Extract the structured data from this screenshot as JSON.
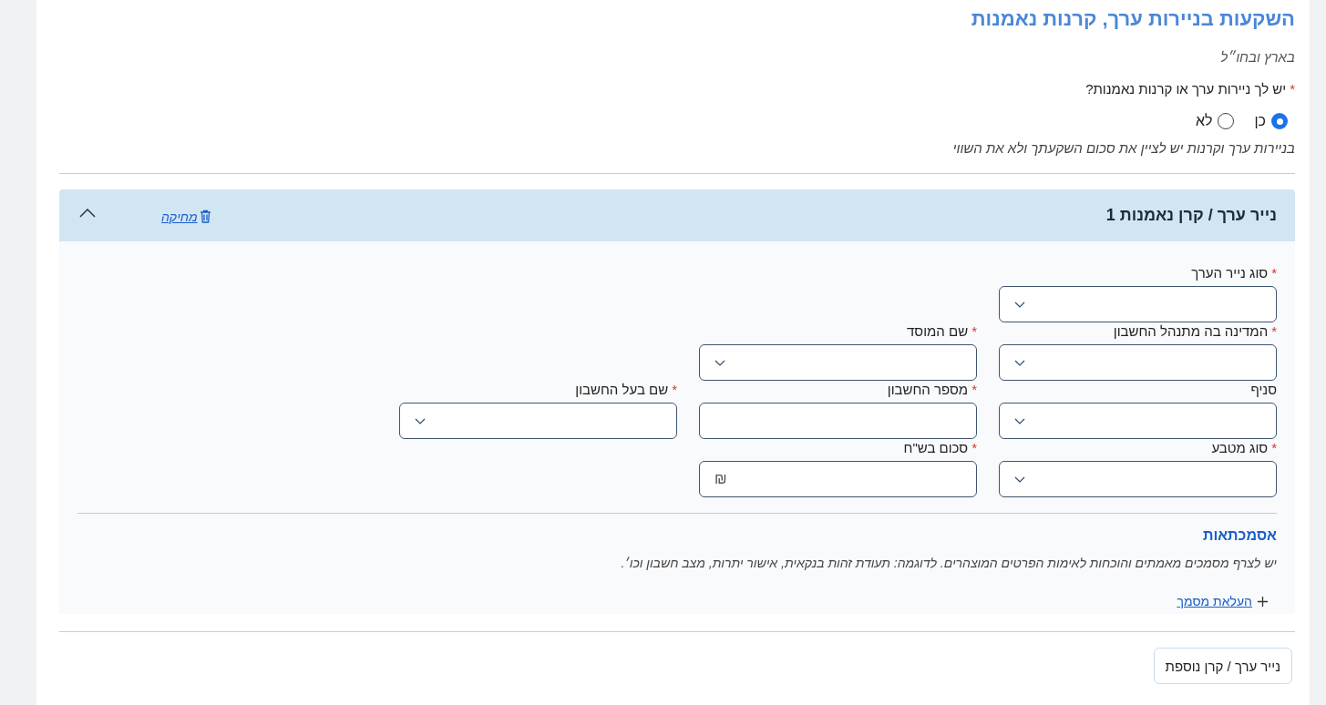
{
  "section": {
    "title": "השקעות בניירות ערך, קרנות נאמנות",
    "subtitle": "בארץ ובחו״ל"
  },
  "question": {
    "label": "יש לך ניירות ערך או קרנות נאמנות?",
    "required_mark": "*",
    "options": [
      {
        "label": "כן",
        "selected": true
      },
      {
        "label": "לא",
        "selected": false
      }
    ],
    "note": "בניירות ערך וקרנות יש לציין את סכום השקעתך ולא את השווי"
  },
  "item": {
    "title": "נייר ערך / קרן נאמנות 1",
    "delete_label": "מחיקה",
    "expanded": true,
    "field_rows": [
      [
        {
          "label": "סוג נייר הערך",
          "required_mark": "*",
          "kind": "select"
        }
      ],
      [
        {
          "label": "המדינה בה מתנהל החשבון",
          "required_mark": "*",
          "kind": "select"
        },
        {
          "label": "שם המוסד",
          "required_mark": "*",
          "kind": "select"
        }
      ],
      [
        {
          "label": "סניף",
          "kind": "select"
        },
        {
          "label": "מספר החשבון",
          "required_mark": "*",
          "kind": "input"
        },
        {
          "label": "שם בעל החשבון",
          "required_mark": "*",
          "kind": "select"
        }
      ],
      [
        {
          "label": "סוג מטבע",
          "required_mark": "*",
          "kind": "select"
        },
        {
          "label": "סכום בש\"ח",
          "required_mark": "*",
          "kind": "currency",
          "unit": "₪"
        }
      ]
    ],
    "documents": {
      "title": "אסמכתאות",
      "note": "יש לצרף מסמכים מאמתים והוכחות לאימות הפרטים המוצהרים. לדוגמה: תעודת זהות בנקאית, אישור יתרות, מצב חשבון וכו׳.",
      "upload_label": "העלאת מסמך"
    }
  },
  "add_button": "נייר ערך / קרן נוספת"
}
